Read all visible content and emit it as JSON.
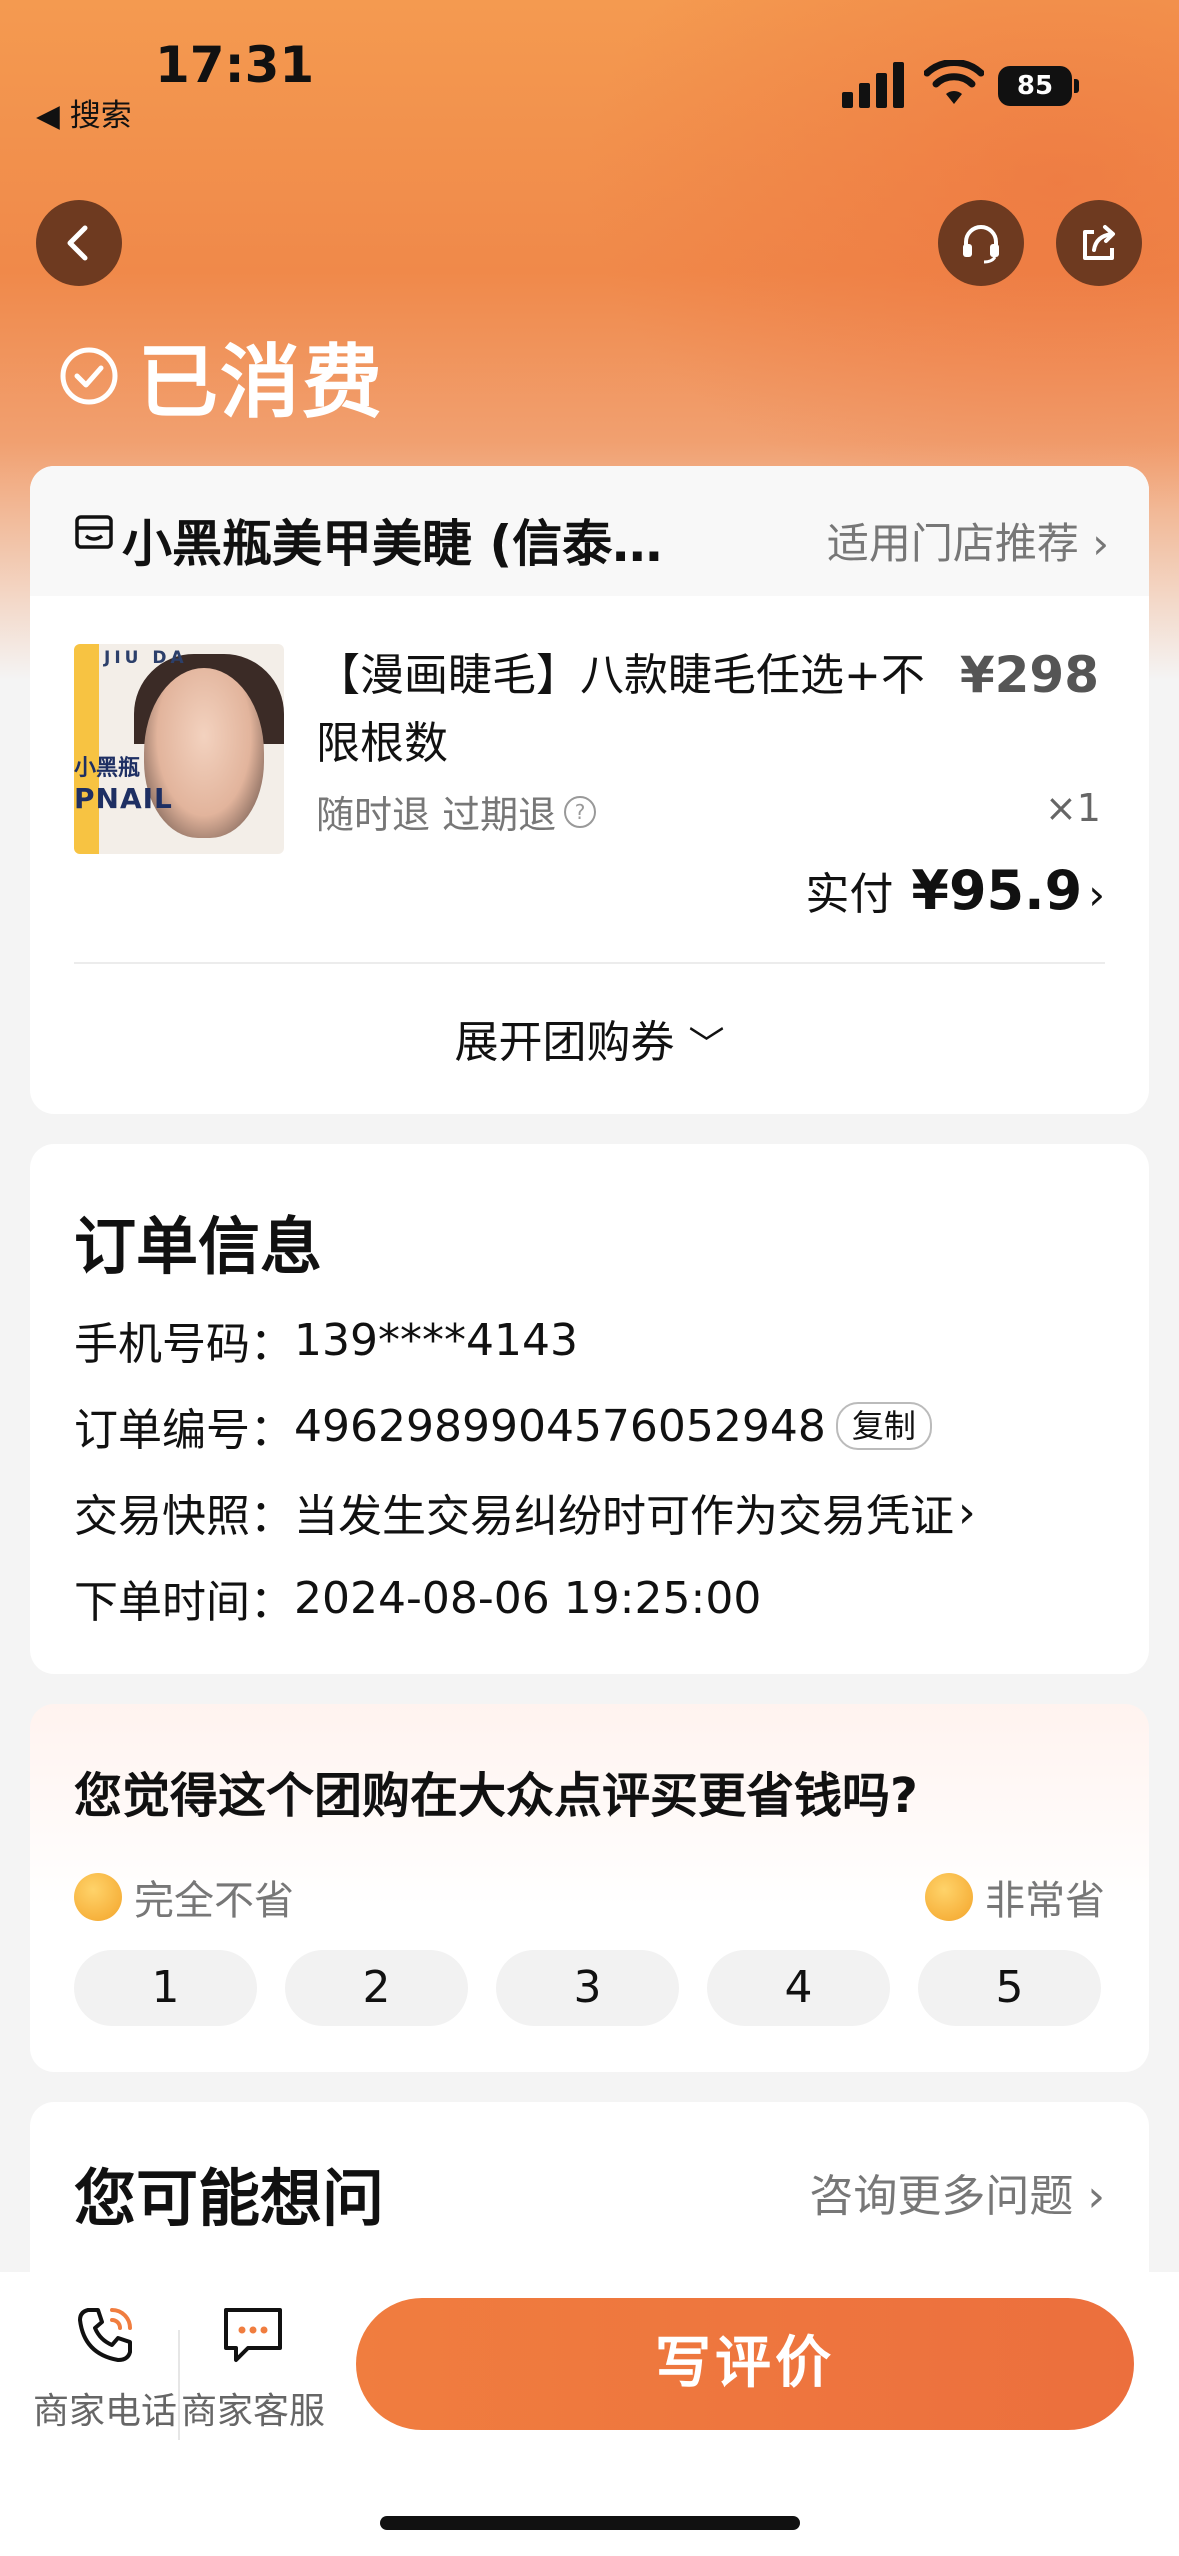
{
  "status_bar": {
    "time": "17:31",
    "back_label": "◀ 搜索",
    "battery": "85"
  },
  "header": {
    "status_title": "已消费"
  },
  "store": {
    "name": "小黑瓶美甲美睫 (信泰…",
    "link": "适用门店推荐"
  },
  "product": {
    "thumb_brand_top": "JIU DA",
    "thumb_brand_cn": "小黑瓶",
    "thumb_brand_en": "PNAIL",
    "title": "【漫画睫毛】八款睫毛任选+不限根数",
    "price": "¥298",
    "refund": "随时退 过期退",
    "quantity": "×1",
    "paid_label": "实付",
    "paid_amount": "¥95.9"
  },
  "expand_label": "展开团购券",
  "order": {
    "title": "订单信息",
    "rows": [
      {
        "label": "手机号码：",
        "value": "139****4143"
      },
      {
        "label": "订单编号：",
        "value": "4962989904576052948"
      },
      {
        "label": "交易快照：",
        "value": "当发生交易纠纷时可作为交易凭证"
      },
      {
        "label": "下单时间：",
        "value": "2024-08-06 19:25:00"
      }
    ],
    "copy_label": "复制"
  },
  "survey": {
    "question": "您觉得这个团购在大众点评买更省钱吗?",
    "low_label": "完全不省",
    "high_label": "非常省",
    "options": [
      "1",
      "2",
      "3",
      "4",
      "5"
    ]
  },
  "ask": {
    "title": "您可能想问",
    "more": "咨询更多问题"
  },
  "bottom": {
    "phone_label": "商家电话",
    "service_label": "商家客服",
    "review_label": "写评价"
  }
}
